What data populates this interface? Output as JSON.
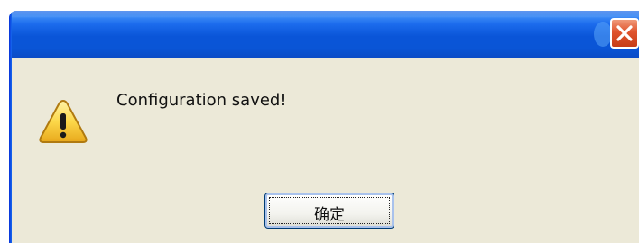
{
  "dialog": {
    "message": "Configuration saved!",
    "ok_label": "确定",
    "icons": {
      "warning": "warning-icon",
      "close": "close-icon"
    }
  },
  "colors": {
    "titlebar": "#0a55d8",
    "client_background": "#ece9d8",
    "close_button": "#e0542d",
    "warning_yellow": "#fcd84a"
  }
}
